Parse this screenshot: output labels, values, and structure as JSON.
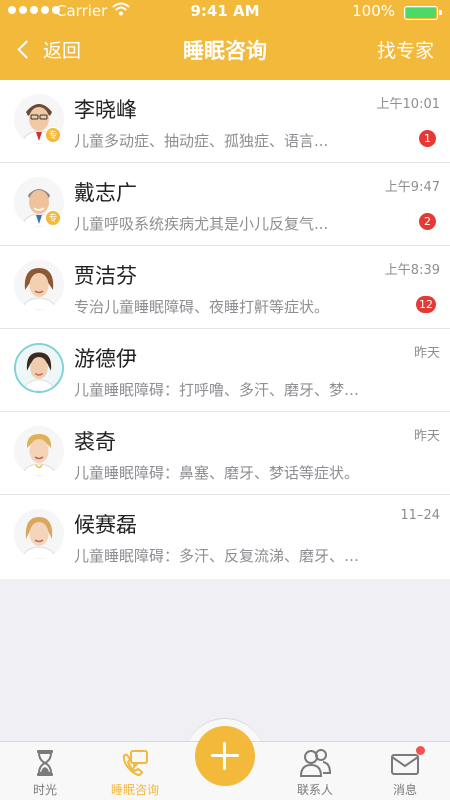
{
  "status_bar": {
    "carrier": "Carrier",
    "time": "9:41 AM",
    "battery": "100%",
    "battery_color": "#4cd964"
  },
  "nav": {
    "back_label": "返回",
    "title": "睡眠咨询",
    "right_action": "找专家"
  },
  "colors": {
    "accent": "#f2b93b",
    "badge": "#e53935"
  },
  "conversations": [
    {
      "name": "李晓峰",
      "desc": "儿童多动症、抽动症、孤独症、语言...",
      "time": "上午10:01",
      "unread": "1",
      "badge": "专"
    },
    {
      "name": "戴志广",
      "desc": "儿童呼吸系统疾病尤其是小儿反复气...",
      "time": "上午9:47",
      "unread": "2",
      "badge": "专"
    },
    {
      "name": "贾洁芬",
      "desc": "专治儿童睡眠障碍、夜睡打鼾等症状。",
      "time": "上午8:39",
      "unread": "12"
    },
    {
      "name": "游德伊",
      "desc": "儿童睡眠障碍：打呼噜、多汗、磨牙、梦话等...",
      "time": "昨天"
    },
    {
      "name": "裘奇",
      "desc": "儿童睡眠障碍：鼻塞、磨牙、梦话等症状。",
      "time": "昨天"
    },
    {
      "name": "候赛磊",
      "desc": "儿童睡眠障碍：多汗、反复流涕、磨牙、梦话...",
      "time": "11–24"
    }
  ],
  "tabbar": {
    "items": [
      {
        "label": "时光",
        "icon": "hourglass-icon"
      },
      {
        "label": "睡眠咨询",
        "icon": "consult-phone-icon"
      },
      {
        "label": "联系人",
        "icon": "contacts-icon"
      },
      {
        "label": "消息",
        "icon": "envelope-icon"
      }
    ],
    "center_icon": "plus-icon"
  }
}
